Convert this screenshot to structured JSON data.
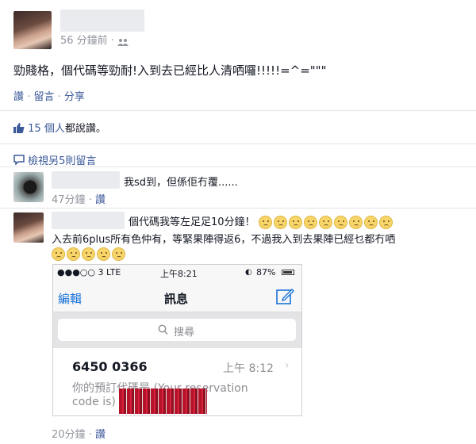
{
  "post": {
    "time": "56 分鐘前",
    "audience_icon": "people-icon",
    "text": "勁賤格，個代碼等勁耐!入到去已經比人清哂囉!!!!!=^=\"\"\"",
    "actions": {
      "like": "讚",
      "comment": "留言",
      "share": "分享",
      "sep": "·"
    }
  },
  "likes": {
    "count_text": "15 個人",
    "suffix": "都說讚。"
  },
  "view_more": "檢視另5則留言",
  "comments": [
    {
      "text": "我sd到，但係佢冇覆......",
      "time": "47分鐘",
      "like": "讚"
    },
    {
      "line1": "個代碼我等左足足10分鐘！",
      "line1_emoji_count": 9,
      "line2": "入去前6plus所有色仲有，等緊果陣得返6，不過我入到去果陣已經乜都冇哂",
      "line3_emoji_count": 5,
      "time": "20分鐘",
      "like": "讚",
      "screenshot": {
        "status_left": "●●●○○ 3  LTE",
        "status_time": "上午8:21",
        "status_battery": "87%",
        "edit": "編輯",
        "title": "訊息",
        "search_placeholder": "搜尋",
        "sender": "6450 0366",
        "msg_time": "上午 8:12",
        "preview_line1": "你的預訂代碼是 (Your reservation",
        "preview_line2": "code is)"
      }
    }
  ],
  "sep": "·"
}
